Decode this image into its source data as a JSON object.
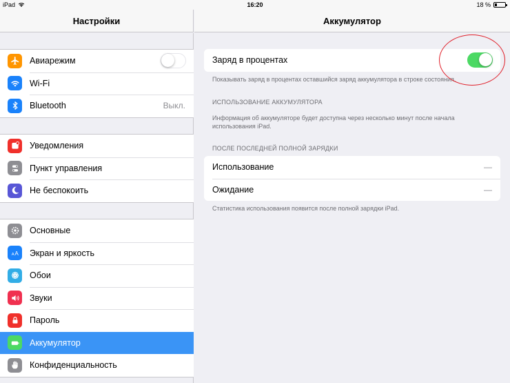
{
  "status_bar": {
    "device": "iPad",
    "time": "16:20",
    "battery_percent_text": "18 %",
    "battery_level": 0.18
  },
  "sidebar": {
    "title": "Настройки",
    "groups": [
      {
        "items": [
          {
            "label": "Авиарежим",
            "icon": "airplane-icon",
            "icon_color": "#ff9500",
            "control": "toggle",
            "toggle_on": false
          },
          {
            "label": "Wi-Fi",
            "icon": "wifi-icon",
            "icon_color": "#1a82fb"
          },
          {
            "label": "Bluetooth",
            "icon": "bluetooth-icon",
            "icon_color": "#1a82fb",
            "value": "Выкл."
          }
        ]
      },
      {
        "items": [
          {
            "label": "Уведомления",
            "icon": "notifications-icon",
            "icon_color": "#f0302b"
          },
          {
            "label": "Пункт управления",
            "icon": "control-center-icon",
            "icon_color": "#8e8e93"
          },
          {
            "label": "Не беспокоить",
            "icon": "moon-icon",
            "icon_color": "#5856d6"
          }
        ]
      },
      {
        "items": [
          {
            "label": "Основные",
            "icon": "gear-icon",
            "icon_color": "#8e8e93"
          },
          {
            "label": "Экран и яркость",
            "icon": "display-icon",
            "icon_color": "#1a82fb"
          },
          {
            "label": "Обои",
            "icon": "wallpaper-icon",
            "icon_color": "#32ade6"
          },
          {
            "label": "Звуки",
            "icon": "speaker-icon",
            "icon_color": "#f0304f"
          },
          {
            "label": "Пароль",
            "icon": "lock-icon",
            "icon_color": "#f0302b"
          },
          {
            "label": "Аккумулятор",
            "icon": "battery-icon",
            "icon_color": "#4cd964",
            "selected": true
          },
          {
            "label": "Конфиденциальность",
            "icon": "hand-icon",
            "icon_color": "#8e8e93"
          }
        ]
      }
    ]
  },
  "detail": {
    "title": "Аккумулятор",
    "percent_row": {
      "label": "Заряд в процентах",
      "toggle_on": true
    },
    "percent_footnote": "Показывать заряд в процентах оставшийся заряд аккумулятора в строке состояния.",
    "usage_header": "ИСПОЛЬЗОВАНИЕ АККУМУЛЯТОРА",
    "usage_footnote": "Информация об аккумуляторе будет доступна через несколько минут после начала использования iPad.",
    "since_header": "ПОСЛЕ ПОСЛЕДНЕЙ ПОЛНОЙ ЗАРЯДКИ",
    "since_rows": [
      {
        "label": "Использование",
        "value": "—"
      },
      {
        "label": "Ожидание",
        "value": "—"
      }
    ],
    "since_footnote": "Статистика использования появится после полной зарядки iPad."
  },
  "colors": {
    "accent": "#3a94f6",
    "toggle_on": "#4cd964",
    "annotation": "#e0202a"
  }
}
